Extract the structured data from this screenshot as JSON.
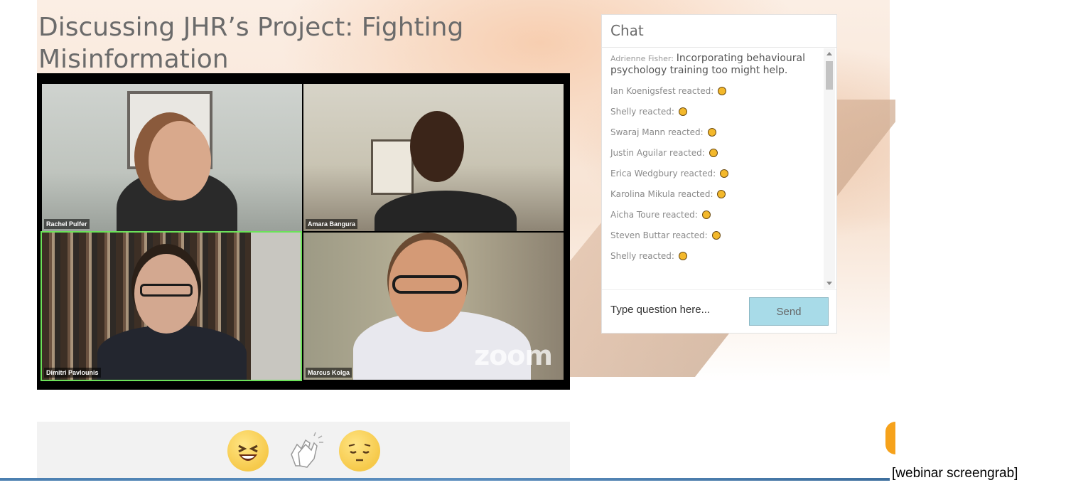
{
  "page": {
    "title": "Discussing JHR’s Project: Fighting Misinformation",
    "caption": "[webinar screengrab]"
  },
  "video": {
    "participants": [
      {
        "name": "Rachel Pulfer",
        "active_speaker": false
      },
      {
        "name": "Amara Bangura",
        "active_speaker": false
      },
      {
        "name": "Dimitri Pavlounis",
        "active_speaker": true
      },
      {
        "name": "Marcus Kolga",
        "active_speaker": false
      }
    ],
    "watermark": "zoom"
  },
  "chat": {
    "title": "Chat",
    "messages": [
      {
        "author": "Adrienne Fisher:",
        "text": "Incorporating behavioural psychology training too might help."
      },
      {
        "author": "Ian Koenigsfest reacted:",
        "text": ""
      },
      {
        "author": "Shelly reacted:",
        "text": ""
      },
      {
        "author": "Swaraj Mann reacted:",
        "text": ""
      },
      {
        "author": "Justin Aguilar reacted:",
        "text": ""
      },
      {
        "author": "Erica Wedgbury reacted:",
        "text": ""
      },
      {
        "author": "Karolina Mikula reacted:",
        "text": ""
      },
      {
        "author": "Aicha Toure reacted:",
        "text": ""
      },
      {
        "author": "Steven Buttar reacted:",
        "text": ""
      },
      {
        "author": "Shelly reacted:",
        "text": ""
      }
    ],
    "input_placeholder": "Type question here...",
    "send_label": "Send"
  },
  "reactions": [
    "laughing-face",
    "clapping-hands",
    "pensive-face"
  ],
  "colors": {
    "active_speaker_border": "#6ce25a",
    "send_button": "#a8dbe8",
    "accent_orange": "#f6a21b"
  }
}
